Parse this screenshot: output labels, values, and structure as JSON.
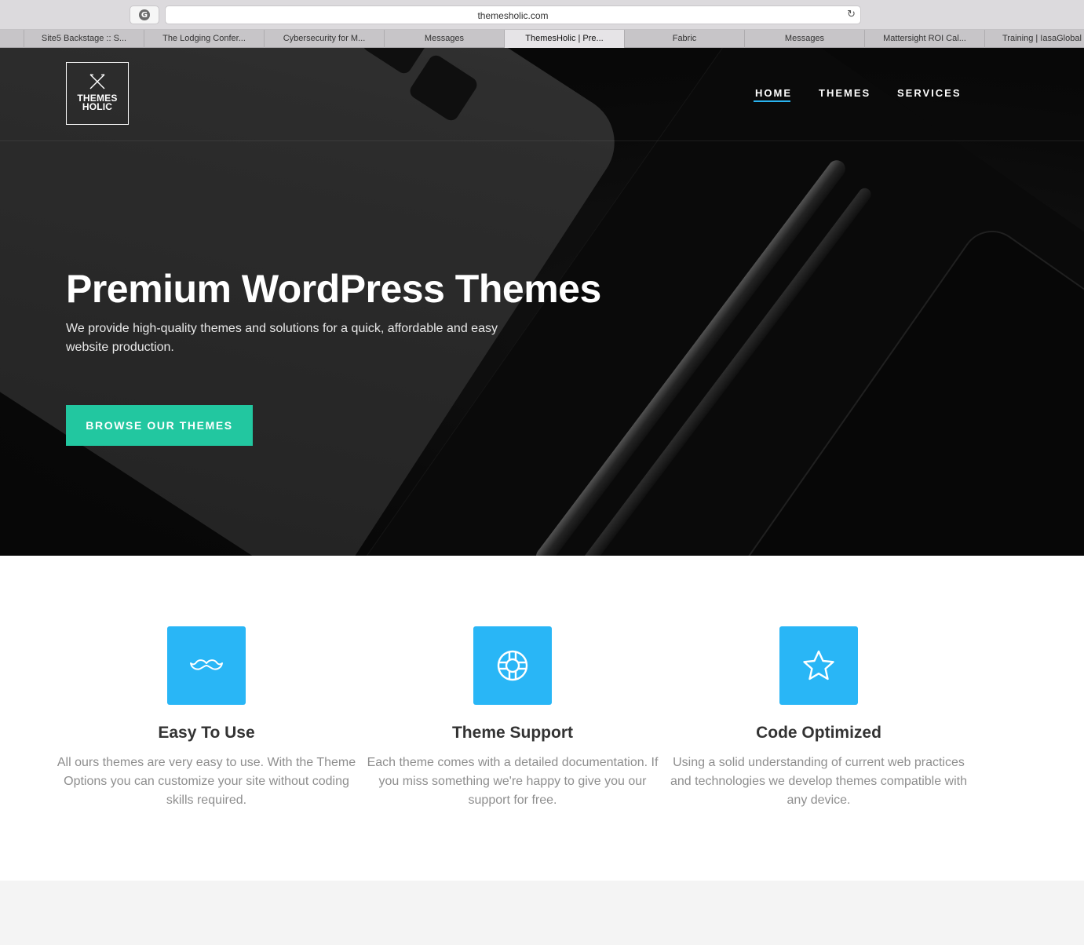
{
  "browser": {
    "url": "themesholic.com",
    "tabs": [
      {
        "label": "Site5 Backstage :: S...",
        "active": false
      },
      {
        "label": "The Lodging Confer...",
        "active": false
      },
      {
        "label": "Cybersecurity for M...",
        "active": false
      },
      {
        "label": "Messages",
        "active": false
      },
      {
        "label": "ThemesHolic | Pre...",
        "active": true
      },
      {
        "label": "Fabric",
        "active": false
      },
      {
        "label": "Messages",
        "active": false
      },
      {
        "label": "Mattersight ROI Cal...",
        "active": false
      },
      {
        "label": "Training | IasaGlobal",
        "active": false
      }
    ]
  },
  "site": {
    "logo": {
      "line1": "THEMES",
      "line2": "HOLIC"
    },
    "nav": [
      {
        "label": "HOME",
        "active": true
      },
      {
        "label": "THEMES",
        "active": false
      },
      {
        "label": "SERVICES",
        "active": false
      }
    ],
    "accent_color": "#2ab4f1",
    "cta_color": "#22c7a0"
  },
  "hero": {
    "title": "Premium WordPress Themes",
    "subtitle": "We provide high-quality themes and solutions for a quick, affordable and easy website production.",
    "cta_label": "BROWSE OUR THEMES"
  },
  "features": [
    {
      "icon": "mustache-icon",
      "title": "Easy To Use",
      "text": "All ours themes are very easy to use. With the Theme Options you can customize your site without coding skills required."
    },
    {
      "icon": "lifebuoy-icon",
      "title": "Theme Support",
      "text": "Each theme comes with a detailed documentation. If you miss something we're happy to give you our support for free."
    },
    {
      "icon": "star-icon",
      "title": "Code Optimized",
      "text": "Using a solid understanding of current web practices and technologies we develop themes compatible with any device."
    }
  ],
  "feature_icon_color": "#29b6f6"
}
